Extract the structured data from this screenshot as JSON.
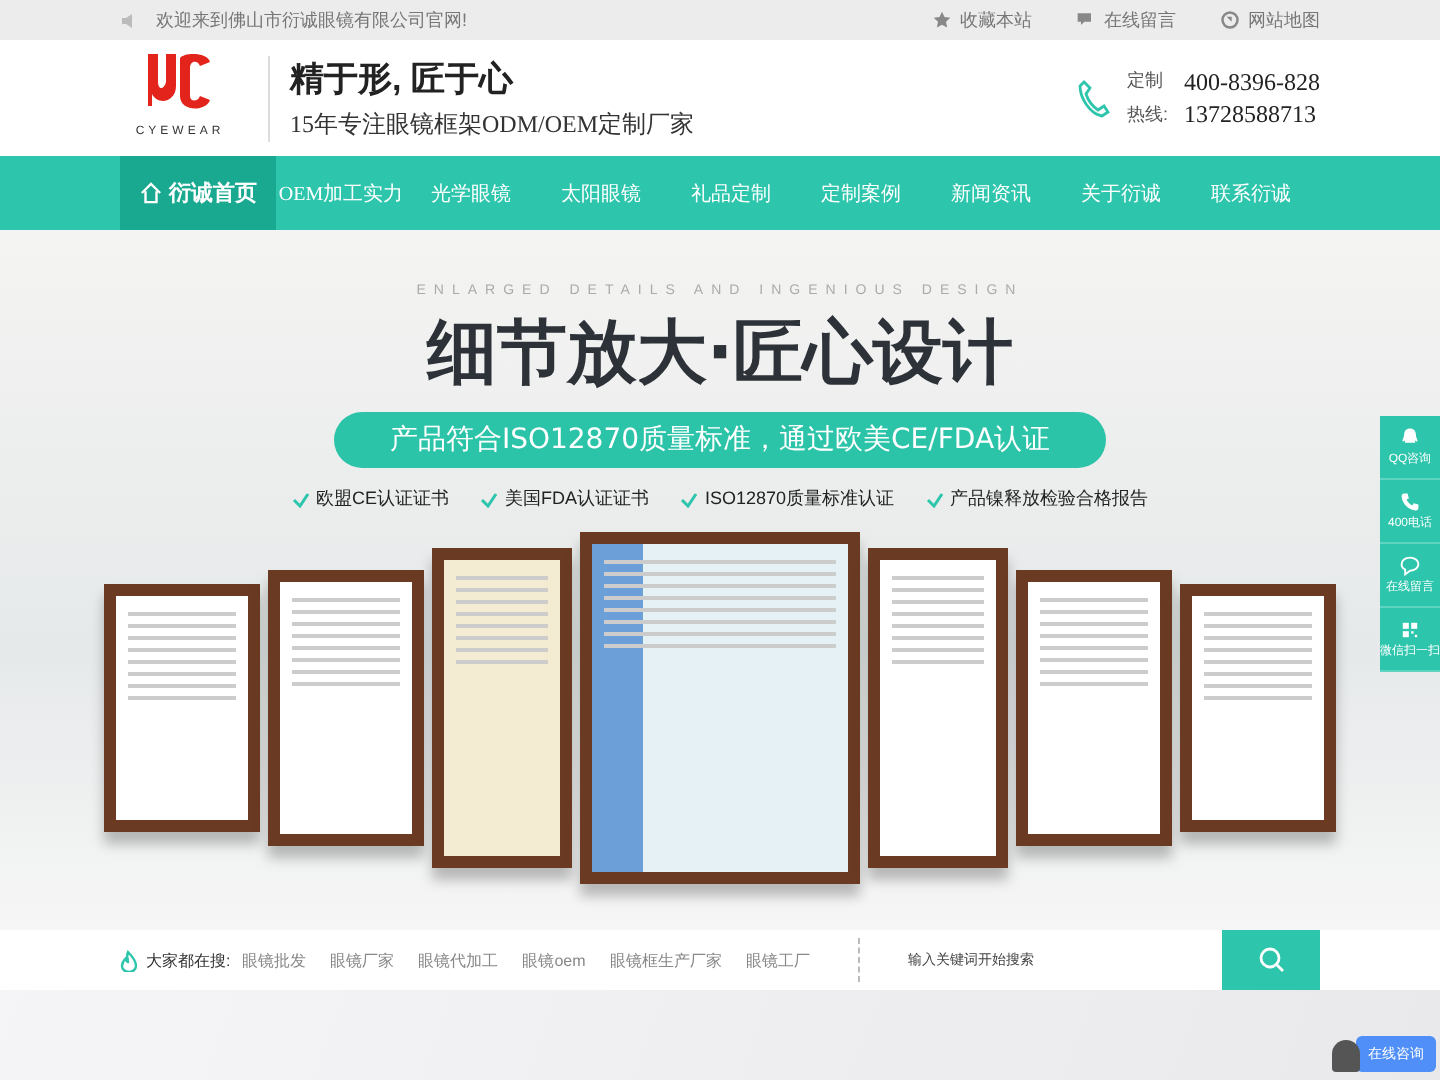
{
  "top_bar": {
    "welcome": "欢迎来到佛山市衍诚眼镜有限公司官网!",
    "links": [
      {
        "label": "收藏本站"
      },
      {
        "label": "在线留言"
      },
      {
        "label": "网站地图"
      }
    ]
  },
  "header": {
    "logo_text": "CYEWEAR",
    "slogan": "精于形, 匠于心",
    "subtitle": "15年专注眼镜框架ODM/OEM定制厂家",
    "hotline_label_1": "定制",
    "hotline_label_2": "热线:",
    "phone_1": "400-8396-828",
    "phone_2": "13728588713"
  },
  "nav": [
    {
      "label": "衍诚首页",
      "selected": true
    },
    {
      "label": "OEM加工实力",
      "selected": false
    },
    {
      "label": "光学眼镜",
      "selected": false
    },
    {
      "label": "太阳眼镜",
      "selected": false
    },
    {
      "label": "礼品定制",
      "selected": false
    },
    {
      "label": "定制案例",
      "selected": false
    },
    {
      "label": "新闻资讯",
      "selected": false
    },
    {
      "label": "关于衍诚",
      "selected": false
    },
    {
      "label": "联系衍诚",
      "selected": false
    }
  ],
  "banner": {
    "eyebrow": "ENLARGED DETAILS AND INGENIOUS DESIGN",
    "headline": "细节放大·匠心设计",
    "pill": "产品符合ISO12870质量标准，通过欧美CE/FDA认证",
    "checks": [
      "欧盟CE认证证书",
      "美国FDA认证证书",
      "ISO12870质量标准认证",
      "产品镍释放检验合格报告"
    ]
  },
  "side_panel": [
    {
      "label": "QQ咨询"
    },
    {
      "label": "400电话"
    },
    {
      "label": "在线留言"
    },
    {
      "label": "微信扫一扫"
    }
  ],
  "search_bar": {
    "label": "大家都在搜:",
    "keywords": [
      "眼镜批发",
      "眼镜厂家",
      "眼镜代加工",
      "眼镜oem",
      "眼镜框生产厂家",
      "眼镜工厂"
    ],
    "placeholder": "输入关键词开始搜索"
  },
  "chat_button": "在线咨询"
}
